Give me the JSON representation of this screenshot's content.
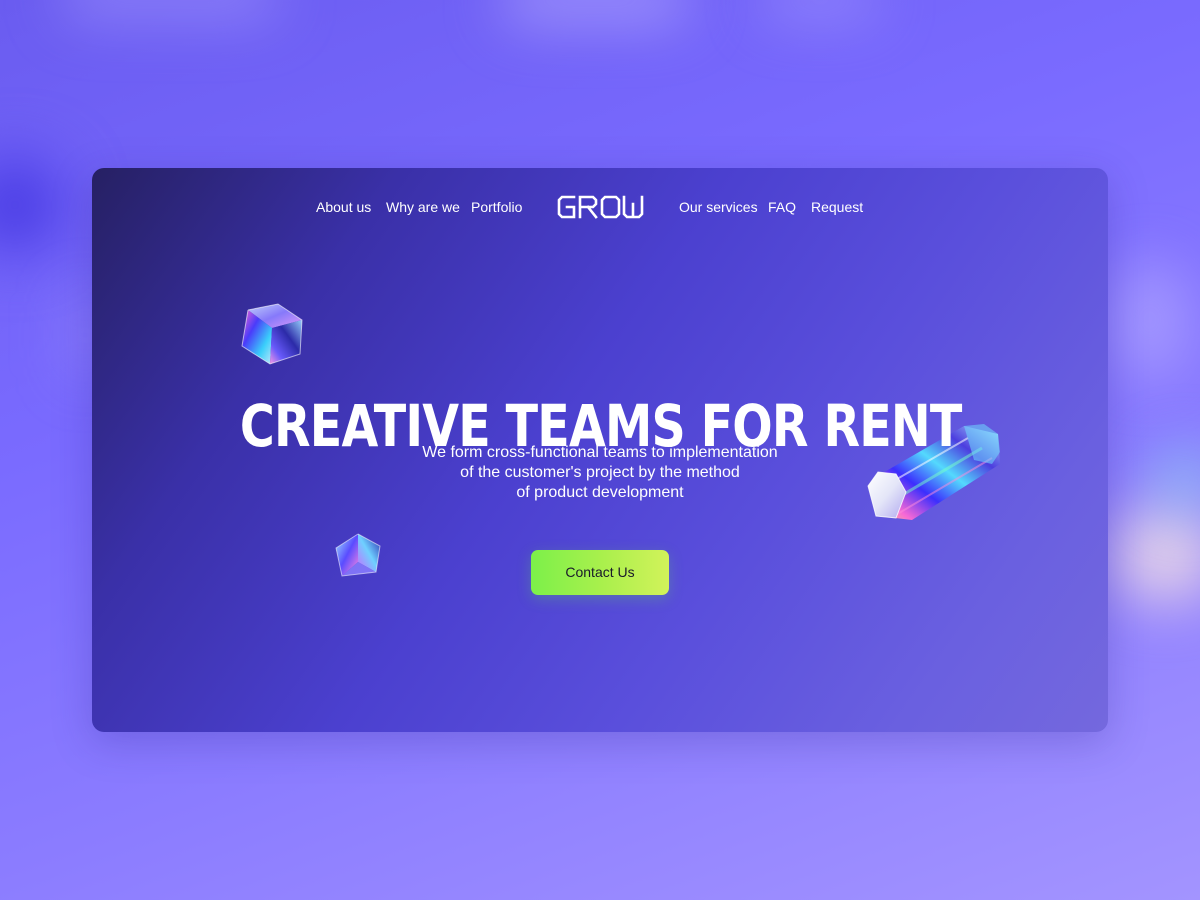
{
  "nav": {
    "left_items": [
      {
        "label": "About us"
      },
      {
        "label": "Why are we"
      },
      {
        "label": "Portfolio"
      }
    ],
    "logo_text": "GROW",
    "right_items": [
      {
        "label": "Our services"
      },
      {
        "label": "FAQ"
      },
      {
        "label": "Request"
      }
    ]
  },
  "hero": {
    "title": "CREATIVE TEAMS FOR RENT",
    "subtitle_lines": [
      "We form cross-functional teams to implementation",
      "of the customer's project by the method",
      "of product development"
    ],
    "cta_label": "Contact Us"
  },
  "colors": {
    "page_background": "#7a6bff",
    "card_dark": "#262063",
    "card_light": "#7468de",
    "cta_gradient_start": "#7cf04a",
    "cta_gradient_end": "#d2f25a",
    "text": "#ffffff"
  },
  "decorations": [
    "glass-cube-icon",
    "glass-octahedron-icon",
    "glass-hexagonal-prism-icon"
  ]
}
